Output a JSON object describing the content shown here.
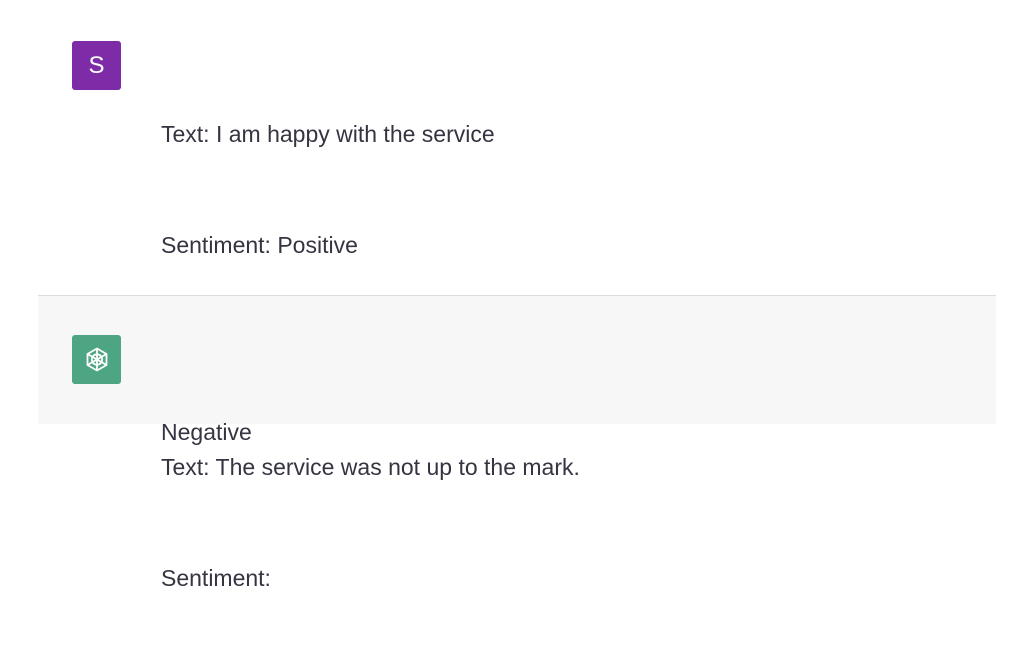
{
  "conversation": {
    "user": {
      "avatar_initial": "S",
      "avatar_color": "#7d2ba6",
      "lines": [
        "Text: I am happy with the service",
        "Sentiment: Positive",
        "",
        "Text: The service was not up to the mark.",
        "Sentiment:"
      ]
    },
    "assistant": {
      "avatar_icon": "openai-logo-icon",
      "avatar_color": "#4ea584",
      "lines": [
        "Negative"
      ]
    }
  }
}
